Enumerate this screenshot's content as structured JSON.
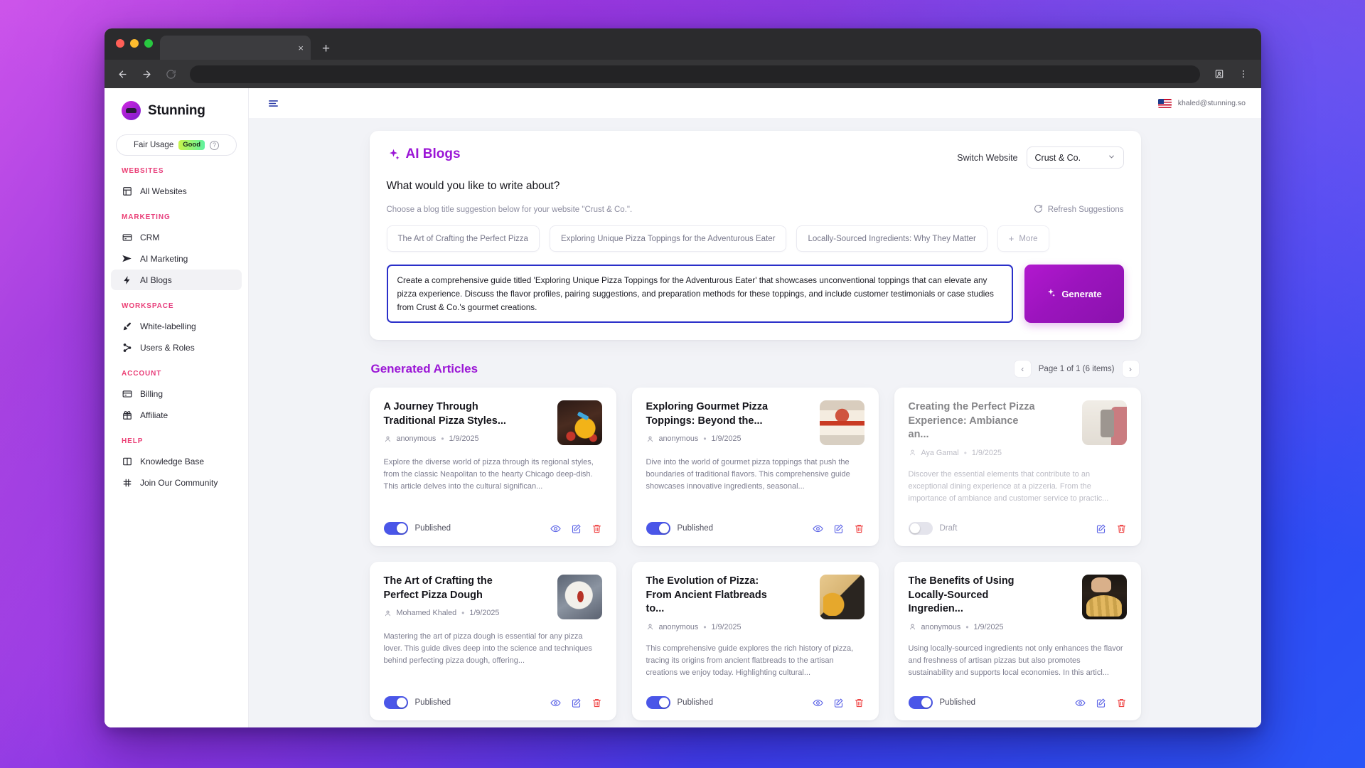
{
  "browser": {
    "tab_close_label": "×",
    "new_tab_label": "+"
  },
  "sidebar": {
    "brand": "Stunning",
    "usage": {
      "label": "Fair Usage",
      "badge": "Good",
      "help": "?"
    },
    "sections": [
      {
        "title": "WEBSITES",
        "items": [
          {
            "label": "All Websites",
            "icon": "layout-icon",
            "active": false
          }
        ]
      },
      {
        "title": "MARKETING",
        "items": [
          {
            "label": "CRM",
            "icon": "card-icon",
            "active": false
          },
          {
            "label": "AI Marketing",
            "icon": "send-icon",
            "active": false
          },
          {
            "label": "AI Blogs",
            "icon": "bolt-icon",
            "active": true
          }
        ]
      },
      {
        "title": "WORKSPACE",
        "items": [
          {
            "label": "White-labelling",
            "icon": "brush-icon",
            "active": false
          },
          {
            "label": "Users & Roles",
            "icon": "network-icon",
            "active": false
          }
        ]
      },
      {
        "title": "ACCOUNT",
        "items": [
          {
            "label": "Billing",
            "icon": "card-icon",
            "active": false
          },
          {
            "label": "Affiliate",
            "icon": "gift-icon",
            "active": false
          }
        ]
      },
      {
        "title": "HELP",
        "items": [
          {
            "label": "Knowledge Base",
            "icon": "book-icon",
            "active": false
          },
          {
            "label": "Join Our Community",
            "icon": "grid-icon",
            "active": false
          }
        ]
      }
    ]
  },
  "topbar": {
    "user_email": "khaled@stunning.so",
    "flag": "us-flag-icon"
  },
  "blog_panel": {
    "title": "AI Blogs",
    "switch_website_label": "Switch Website",
    "selected_website": "Crust & Co.",
    "question": "What would you like to write about?",
    "subtitle": "Choose a blog title suggestion below for your website \"Crust & Co.\".",
    "refresh_label": "Refresh Suggestions",
    "suggestions": [
      "The Art of Crafting the Perfect Pizza",
      "Exploring Unique Pizza Toppings for the Adventurous Eater",
      "Locally-Sourced Ingredients: Why They Matter"
    ],
    "more_label": "More",
    "prompt_value": "Create a comprehensive guide titled 'Exploring Unique Pizza Toppings for the Adventurous Eater' that showcases unconventional toppings that can elevate any pizza experience. Discuss the flavor profiles, pairing suggestions, and preparation methods for these toppings, and include customer testimonials or case studies from Crust & Co.'s gourmet creations.",
    "prompt_placeholder": "What would you like to write about?",
    "generate_label": "Generate"
  },
  "articles_panel": {
    "title": "Generated Articles",
    "pagination": {
      "prev": "‹",
      "next": "›",
      "text": "Page 1 of 1 (6 items)"
    },
    "cards": [
      {
        "title": "A Journey Through Traditional Pizza Styles...",
        "author": "anonymous",
        "date": "1/9/2025",
        "excerpt": "Explore the diverse world of pizza through its regional styles, from the classic Neapolitan to the hearty Chicago deep-dish. This article delves into the cultural significan...",
        "status": "Published",
        "published": true,
        "thumb": "t1"
      },
      {
        "title": "Exploring Gourmet Pizza Toppings: Beyond the...",
        "author": "anonymous",
        "date": "1/9/2025",
        "excerpt": "Dive into the world of gourmet pizza toppings that push the boundaries of traditional flavors. This comprehensive guide showcases innovative ingredients, seasonal...",
        "status": "Published",
        "published": true,
        "thumb": "t2"
      },
      {
        "title": "Creating the Perfect Pizza Experience: Ambiance an...",
        "author": "Aya Gamal",
        "date": "1/9/2025",
        "excerpt": "Discover the essential elements that contribute to an exceptional dining experience at a pizzeria. From the importance of ambiance and customer service to practic...",
        "status": "Draft",
        "published": false,
        "thumb": "t3"
      },
      {
        "title": "The Art of Crafting the Perfect Pizza Dough",
        "author": "Mohamed Khaled",
        "date": "1/9/2025",
        "excerpt": "Mastering the art of pizza dough is essential for any pizza lover. This guide dives deep into the science and techniques behind perfecting pizza dough, offering...",
        "status": "Published",
        "published": true,
        "thumb": "t4"
      },
      {
        "title": "The Evolution of Pizza: From Ancient Flatbreads to...",
        "author": "anonymous",
        "date": "1/9/2025",
        "excerpt": "This comprehensive guide explores the rich history of pizza, tracing its origins from ancient flatbreads to the artisan creations we enjoy today. Highlighting cultural...",
        "status": "Published",
        "published": true,
        "thumb": "t5"
      },
      {
        "title": "The Benefits of Using Locally-Sourced Ingredien...",
        "author": "anonymous",
        "date": "1/9/2025",
        "excerpt": "Using locally-sourced ingredients not only enhances the flavor and freshness of artisan pizzas but also promotes sustainability and supports local economies. In this articl...",
        "status": "Published",
        "published": true,
        "thumb": "t6"
      }
    ]
  },
  "colors": {
    "brand_purple": "#9b16d6",
    "section_pink": "#ef3f6e",
    "toggle_on": "#4a56e8",
    "delete_red": "#ef4444",
    "prompt_border": "#2a2fc9"
  }
}
